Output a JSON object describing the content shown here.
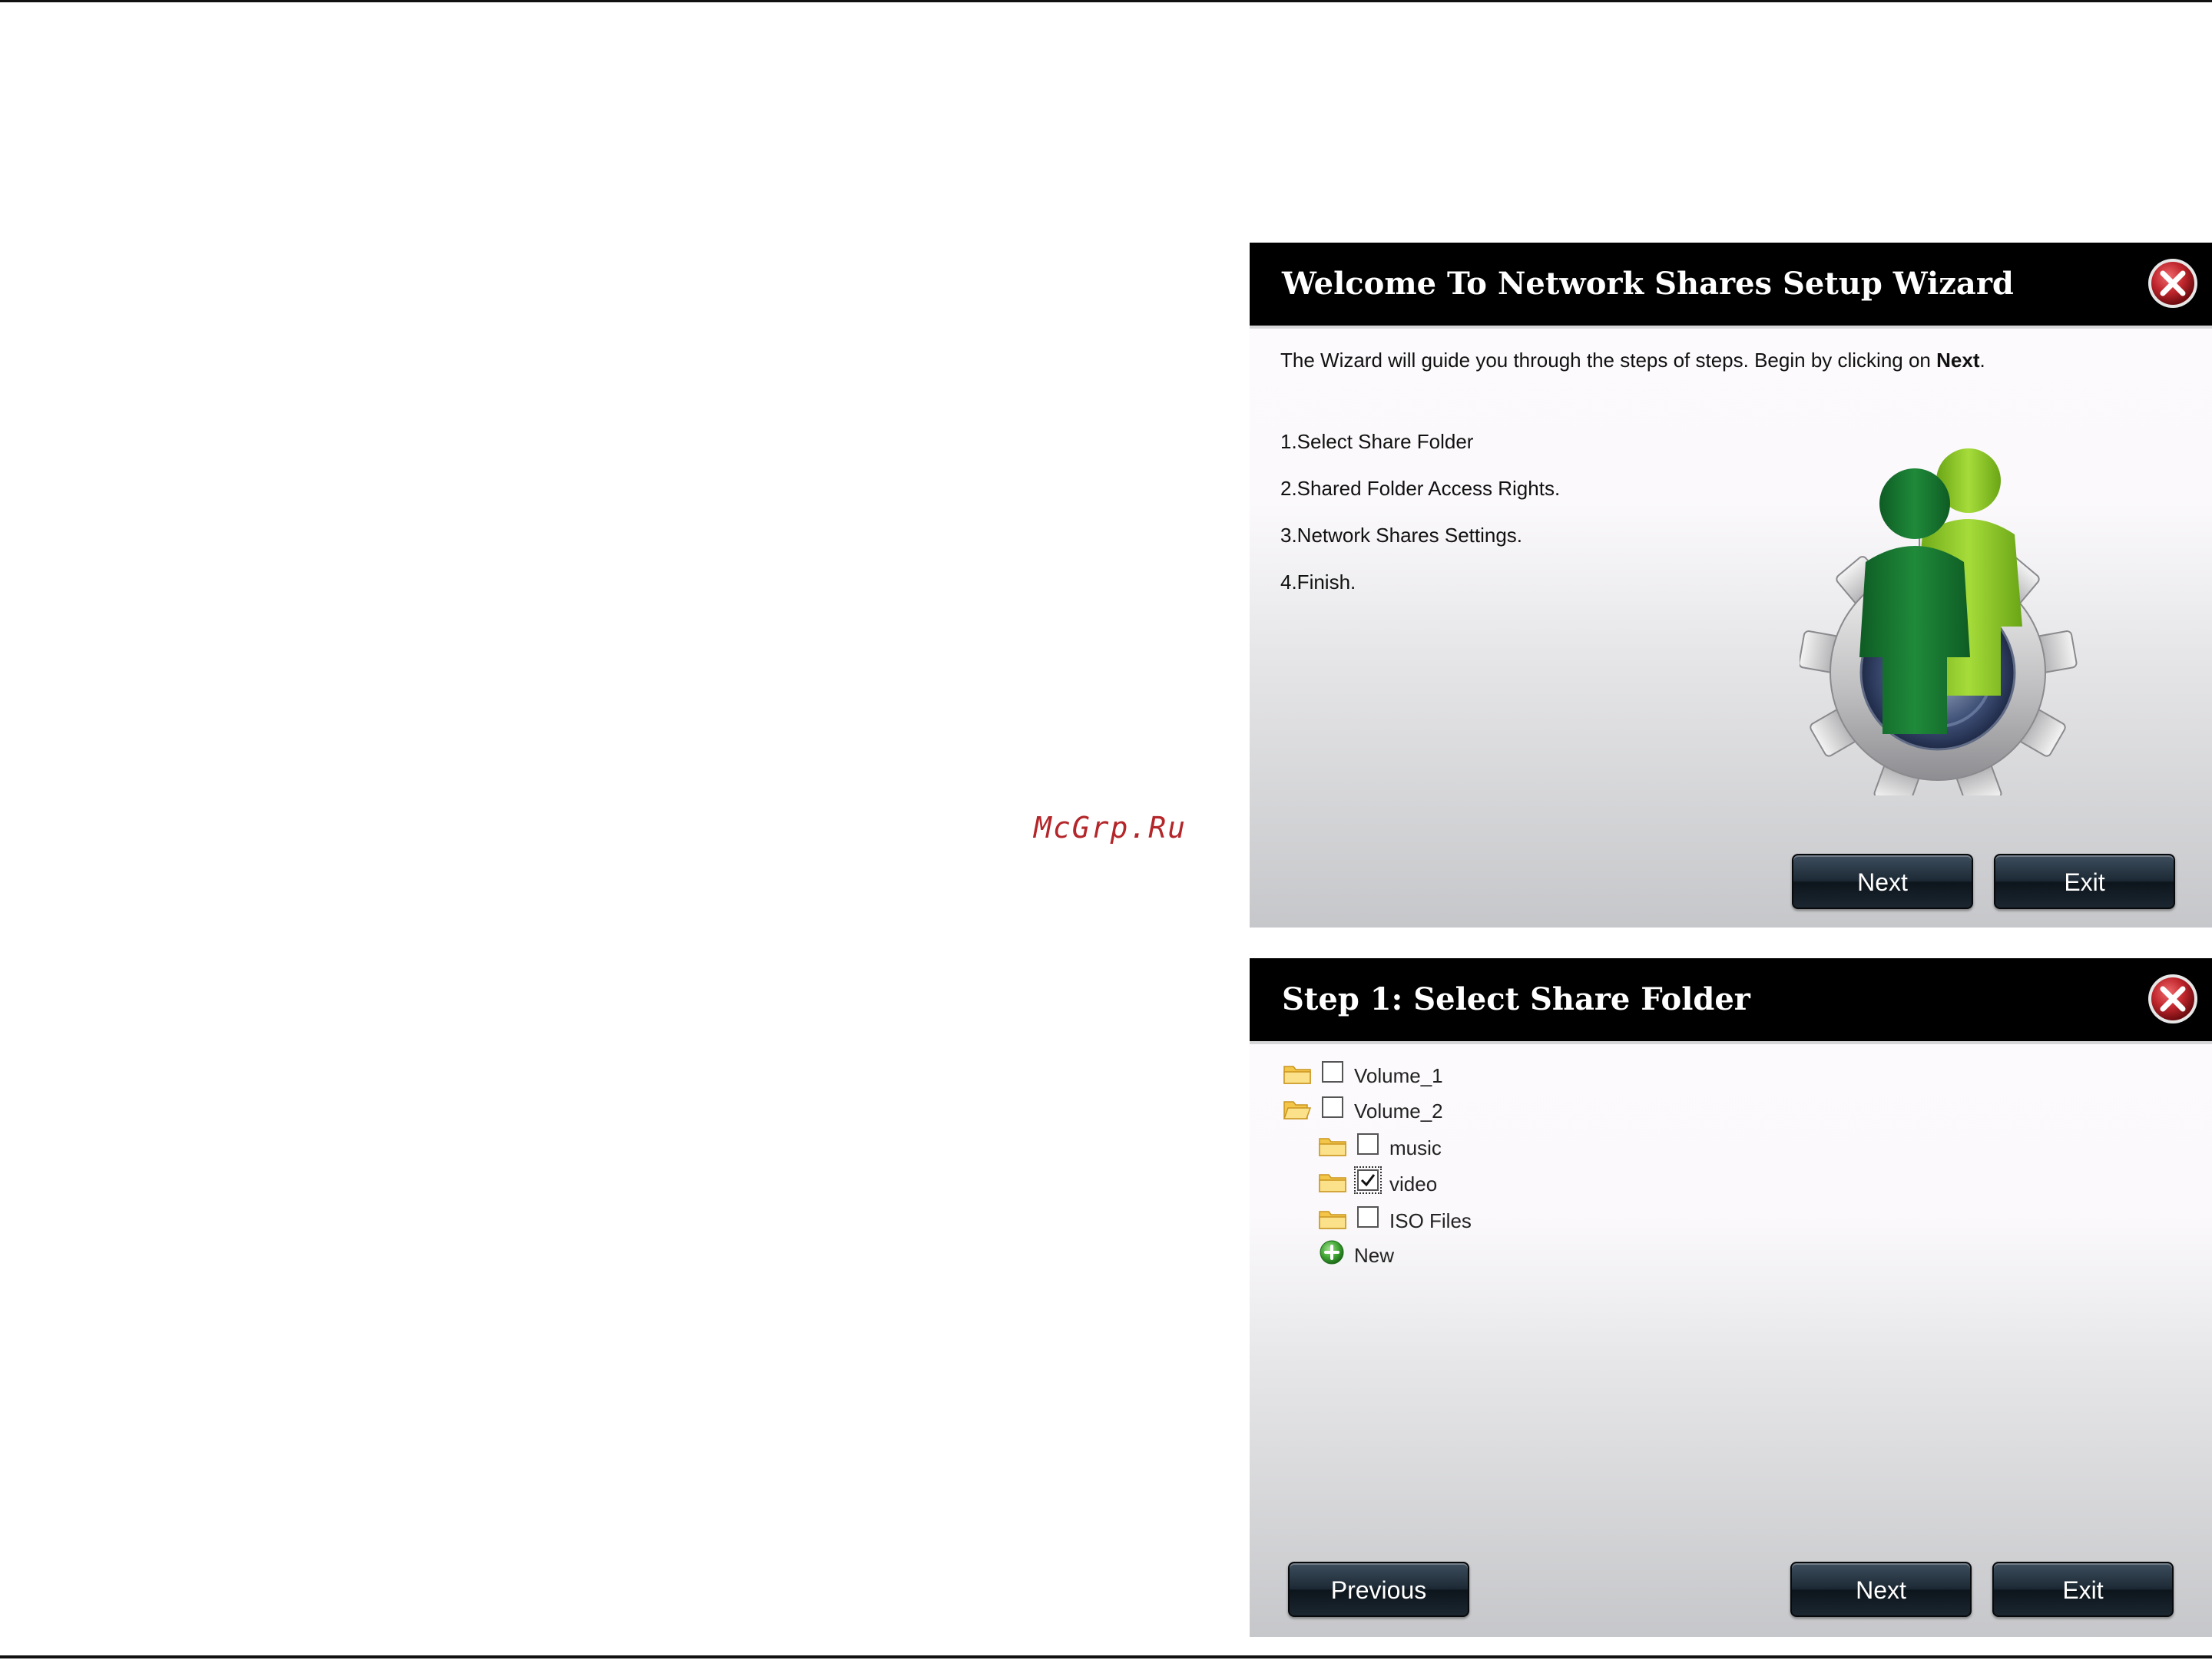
{
  "watermark": "McGrp.Ru",
  "wizard_welcome": {
    "title": "Welcome To Network Shares Setup Wizard",
    "intro_prefix": "The Wizard will guide you through the steps of steps. Begin by clicking on ",
    "intro_emphasis": "Next",
    "intro_suffix": ".",
    "steps": [
      "1.Select Share Folder",
      "2.Shared Folder Access Rights.",
      "3.Network Shares Settings.",
      "4.Finish."
    ],
    "next_label": "Next",
    "exit_label": "Exit"
  },
  "wizard_step1": {
    "title": "Step 1: Select Share Folder",
    "tree": [
      {
        "label": "Volume_1",
        "checked": false,
        "level": 0,
        "open": false
      },
      {
        "label": "Volume_2",
        "checked": false,
        "level": 0,
        "open": true
      },
      {
        "label": "music",
        "checked": false,
        "level": 1,
        "open": false
      },
      {
        "label": "video",
        "checked": true,
        "level": 1,
        "open": false
      },
      {
        "label": "ISO Files",
        "checked": false,
        "level": 1,
        "open": false
      }
    ],
    "new_label": "New",
    "previous_label": "Previous",
    "next_label": "Next",
    "exit_label": "Exit"
  },
  "icons": {
    "close": "close-icon",
    "folder": "folder-icon",
    "checkbox": "checkbox-icon",
    "add": "add-icon",
    "art": "users-gear-icon"
  },
  "colors": {
    "titlebar": "#000000",
    "close": "#c0272d",
    "button": "#1d2a36",
    "watermark": "#b3262a",
    "person_dark": "#1f8a3a",
    "person_light": "#8ccc2a"
  }
}
